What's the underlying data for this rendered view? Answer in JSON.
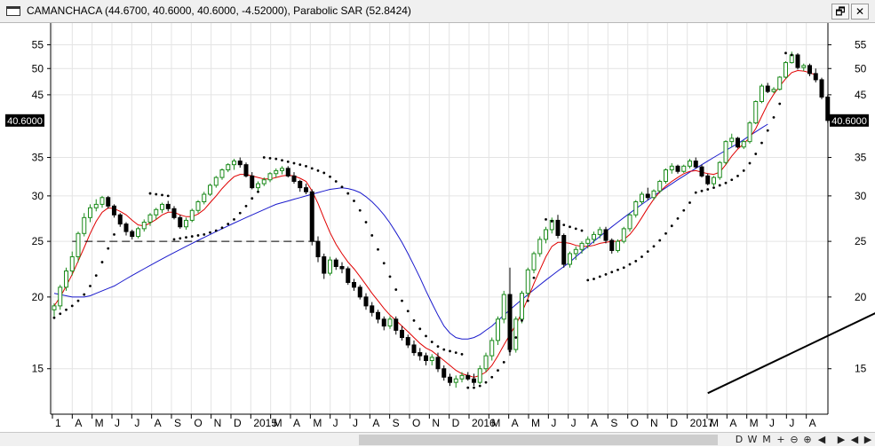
{
  "window": {
    "title": "CAMANCHACA (44.6700, 40.6000, 40.6000, -4.52000), Parabolic SAR (52.8424)",
    "restore_glyph": "🗗",
    "close_glyph": "✕"
  },
  "colors": {
    "up_candle": "#1a8a1a",
    "down_candle": "#000000",
    "ma_short": "#e00000",
    "ma_long": "#1a1acc",
    "sar": "#000000",
    "trendline": "#000000",
    "support": "#000000",
    "grid": "#e4e4e4",
    "price_label_bg": "#000000",
    "price_label_fg": "#ffffff"
  },
  "chart_data": {
    "type": "candlestick",
    "title": "CAMANCHACA (44.6700, 40.6000, 40.6000, -4.52000), Parabolic SAR (52.8424)",
    "period": "weekly",
    "y_scale": "log",
    "ylim": [
      12.5,
      60
    ],
    "y_ticks": [
      15,
      20,
      25,
      30,
      35,
      45,
      50,
      55
    ],
    "last_price_label": "40.6000",
    "last_price": 40.6,
    "grid": true,
    "x_ticks": [
      "1",
      "A",
      "M",
      "J",
      "J",
      "A",
      "S",
      "O",
      "N",
      "D",
      "2015",
      "M",
      "A",
      "M",
      "J",
      "J",
      "A",
      "S",
      "O",
      "N",
      "D",
      "2016",
      "M",
      "A",
      "M",
      "J",
      "J",
      "A",
      "S",
      "O",
      "N",
      "D",
      "2017",
      "M",
      "A",
      "M",
      "J",
      "J",
      "A"
    ],
    "bars": [
      [
        19,
        19.5,
        18.5,
        19.3
      ],
      [
        19.3,
        21,
        19,
        20.8
      ],
      [
        20.8,
        22.5,
        20.5,
        22.2
      ],
      [
        22.2,
        24,
        21.8,
        23.5
      ],
      [
        23.5,
        26,
        23,
        25.8
      ],
      [
        25.8,
        28,
        25.5,
        27.5
      ],
      [
        27.5,
        29,
        27,
        28.6
      ],
      [
        28.6,
        29.6,
        28.2,
        29
      ],
      [
        29,
        30,
        28.6,
        29.8
      ],
      [
        29.8,
        30,
        28.5,
        28.8
      ],
      [
        28.8,
        29,
        27.5,
        27.8
      ],
      [
        27.8,
        28,
        26.5,
        26.8
      ],
      [
        26.8,
        27,
        25.6,
        26
      ],
      [
        26,
        26.2,
        25.2,
        25.5
      ],
      [
        25.5,
        26.5,
        25.3,
        26.3
      ],
      [
        26.3,
        27.3,
        26,
        27
      ],
      [
        27,
        28,
        26.6,
        27.8
      ],
      [
        27.8,
        28.6,
        27.3,
        28.4
      ],
      [
        28.4,
        29.2,
        28,
        29
      ],
      [
        29,
        29.4,
        28.2,
        28.5
      ],
      [
        28.5,
        28.8,
        27.3,
        27.5
      ],
      [
        27.5,
        27.8,
        26.3,
        26.5
      ],
      [
        26.5,
        27.5,
        26.2,
        27.2
      ],
      [
        27.2,
        28.5,
        27,
        28.3
      ],
      [
        28.3,
        29.5,
        28,
        29.3
      ],
      [
        29.3,
        30.5,
        29,
        30.2
      ],
      [
        30.2,
        31.5,
        30,
        31.3
      ],
      [
        31.3,
        32.5,
        31,
        32.3
      ],
      [
        32.3,
        33.5,
        32,
        33.3
      ],
      [
        33.3,
        34.2,
        33,
        34
      ],
      [
        34,
        34.8,
        33.3,
        34.5
      ],
      [
        34.5,
        35,
        33.6,
        34
      ],
      [
        34,
        34.3,
        32.3,
        32.5
      ],
      [
        32.5,
        33,
        30.8,
        31
      ],
      [
        31,
        31.8,
        30.5,
        31.5
      ],
      [
        31.5,
        32.3,
        31.2,
        32
      ],
      [
        32,
        33,
        31.7,
        32.8
      ],
      [
        32.8,
        33.5,
        32.3,
        33.2
      ],
      [
        33.2,
        33.8,
        32.7,
        33.5
      ],
      [
        33.5,
        33.8,
        32.3,
        32.5
      ],
      [
        32.5,
        33,
        31.5,
        31.8
      ],
      [
        31.8,
        32,
        30.5,
        31
      ],
      [
        31,
        31.5,
        30.2,
        30.5
      ],
      [
        30.5,
        30.8,
        24.6,
        25
      ],
      [
        25,
        25.5,
        23,
        23.5
      ],
      [
        23.5,
        23.8,
        21.5,
        22
      ],
      [
        22,
        23.5,
        21.8,
        23.2
      ],
      [
        23.2,
        23.4,
        22.3,
        22.6
      ],
      [
        22.6,
        23,
        22,
        22.4
      ],
      [
        22.4,
        22.6,
        21,
        21.2
      ],
      [
        21.2,
        21.5,
        20.5,
        20.8
      ],
      [
        20.8,
        21,
        19.8,
        20
      ],
      [
        20,
        20.3,
        19,
        19.3
      ],
      [
        19.3,
        19.6,
        18.5,
        18.8
      ],
      [
        18.8,
        19,
        18,
        18.3
      ],
      [
        18.3,
        18.5,
        17.5,
        17.8
      ],
      [
        17.8,
        18.5,
        17.6,
        18.3
      ],
      [
        18.3,
        18.5,
        17.2,
        17.5
      ],
      [
        17.5,
        17.8,
        16.8,
        17
      ],
      [
        17,
        17.2,
        16.3,
        16.5
      ],
      [
        16.5,
        16.8,
        15.8,
        16
      ],
      [
        16,
        16.3,
        15.5,
        15.8
      ],
      [
        15.8,
        16,
        15.2,
        15.5
      ],
      [
        15.5,
        15.9,
        15.2,
        15.7
      ],
      [
        15.7,
        16,
        14.8,
        15
      ],
      [
        15,
        15.2,
        14.3,
        14.5
      ],
      [
        14.5,
        14.7,
        14,
        14.2
      ],
      [
        14.2,
        14.6,
        13.9,
        14.4
      ],
      [
        14.4,
        14.8,
        14.2,
        14.6
      ],
      [
        14.6,
        14.8,
        14.3,
        14.4
      ],
      [
        14.4,
        14.7,
        14,
        14.2
      ],
      [
        14.2,
        15.2,
        14.1,
        15
      ],
      [
        15,
        16,
        14.8,
        15.8
      ],
      [
        15.8,
        17,
        15.5,
        16.8
      ],
      [
        16.8,
        18.5,
        16.5,
        18.3
      ],
      [
        18.3,
        20.5,
        18,
        20.2
      ],
      [
        20.2,
        22.5,
        15.8,
        16.2
      ],
      [
        16.2,
        18.5,
        16,
        18.3
      ],
      [
        18.3,
        20.5,
        18,
        20.3
      ],
      [
        20.3,
        22.5,
        20,
        22.3
      ],
      [
        22.3,
        24,
        22,
        23.8
      ],
      [
        23.8,
        25.5,
        23.5,
        25.2
      ],
      [
        25.2,
        26.5,
        24.8,
        26.2
      ],
      [
        26.2,
        27.5,
        25.8,
        27.2
      ],
      [
        27.2,
        27.8,
        25.3,
        25.6
      ],
      [
        25.6,
        25.8,
        22.5,
        22.8
      ],
      [
        22.8,
        24,
        22.5,
        23.8
      ],
      [
        23.8,
        24.5,
        23.2,
        24.2
      ],
      [
        24.2,
        25,
        23.8,
        24.8
      ],
      [
        24.8,
        25.5,
        24.3,
        25.2
      ],
      [
        25.2,
        26,
        24.8,
        25.7
      ],
      [
        25.7,
        26.5,
        25.3,
        26.2
      ],
      [
        26.2,
        26.5,
        24.8,
        25.1
      ],
      [
        25.1,
        25.3,
        23.8,
        24.1
      ],
      [
        24.1,
        25.2,
        23.9,
        25
      ],
      [
        25,
        26.5,
        24.8,
        26.3
      ],
      [
        26.3,
        28,
        26,
        27.8
      ],
      [
        27.8,
        29.5,
        27.5,
        29.3
      ],
      [
        29.3,
        30.5,
        29,
        30.2
      ],
      [
        30.2,
        31,
        29.5,
        29.8
      ],
      [
        29.8,
        30.8,
        29.5,
        30.6
      ],
      [
        30.6,
        32,
        30.3,
        31.8
      ],
      [
        31.8,
        33.5,
        31.5,
        33.3
      ],
      [
        33.3,
        34.2,
        32.8,
        33.8
      ],
      [
        33.8,
        34,
        32.8,
        33.1
      ],
      [
        33.1,
        34,
        32.9,
        33.8
      ],
      [
        33.8,
        34.8,
        33.5,
        34.5
      ],
      [
        34.5,
        35,
        33.5,
        33.7
      ],
      [
        33.7,
        34,
        32.3,
        32.5
      ],
      [
        32.5,
        32.8,
        31.3,
        31.5
      ],
      [
        31.5,
        32.5,
        31.2,
        32.3
      ],
      [
        32.3,
        34.5,
        32,
        34.3
      ],
      [
        34.3,
        37.5,
        34,
        37.3
      ],
      [
        37.3,
        38.5,
        36.5,
        37.8
      ],
      [
        37.8,
        38,
        36.3,
        36.5
      ],
      [
        36.5,
        37.5,
        36.2,
        37.3
      ],
      [
        37.3,
        40.5,
        37,
        40.2
      ],
      [
        40.2,
        44,
        40,
        43.8
      ],
      [
        43.8,
        47,
        43.5,
        46.6
      ],
      [
        46.6,
        47.2,
        45.3,
        45.6
      ],
      [
        45.6,
        46.4,
        45.3,
        46
      ],
      [
        46,
        48.5,
        45.8,
        48.3
      ],
      [
        48.3,
        51.5,
        48,
        51.2
      ],
      [
        51.2,
        53.5,
        51,
        52.8
      ],
      [
        52.8,
        53.2,
        49.8,
        50.2
      ],
      [
        50.2,
        51,
        49.5,
        50.6
      ],
      [
        50.6,
        51,
        48.5,
        49
      ],
      [
        49,
        50,
        47.3,
        47.8
      ],
      [
        47.8,
        48.2,
        44.2,
        44.6
      ],
      [
        44.6,
        45,
        40.2,
        40.6
      ]
    ],
    "series": [
      {
        "name": "Parabolic SAR",
        "style": "dots",
        "values": [
          18.4,
          18.7,
          19,
          19.3,
          19.7,
          20.2,
          20.9,
          21.8,
          23,
          24.3,
          25.7,
          null,
          null,
          null,
          null,
          null,
          30.3,
          30.2,
          30.1,
          30,
          25.2,
          25.3,
          25.4,
          25.5,
          25.6,
          25.7,
          25.9,
          26.1,
          26.4,
          26.8,
          27.3,
          28,
          28.8,
          29.7,
          30.5,
          35,
          34.9,
          34.8,
          34.6,
          34.4,
          34.2,
          34,
          33.8,
          33.5,
          33.2,
          32.9,
          32.4,
          31.8,
          31.1,
          30.3,
          29.4,
          28.3,
          27,
          25.6,
          24.2,
          22.9,
          21.7,
          20.6,
          19.7,
          18.9,
          18.2,
          17.6,
          17.1,
          16.7,
          16.4,
          16.2,
          16.1,
          16,
          15.9,
          13.9,
          13.9,
          14,
          14.2,
          14.5,
          14.9,
          15.4,
          16.1,
          17,
          18.2,
          19.7,
          21.6,
          null,
          27.3,
          27.1,
          26.9,
          26.7,
          26.5,
          26.3,
          26.1,
          21.4,
          21.5,
          21.7,
          21.9,
          22.1,
          22.3,
          22.5,
          22.8,
          23.1,
          23.5,
          24,
          24.5,
          25.1,
          25.8,
          26.6,
          27.4,
          28.3,
          29.2,
          30.4,
          30.6,
          30.8,
          31,
          31.3,
          31.6,
          32,
          32.5,
          33.2,
          34.2,
          35.5,
          37.1,
          39,
          41.1,
          43.4,
          53.2,
          52.8
        ]
      },
      {
        "name": "MA short",
        "style": "line",
        "values": [
          19.3,
          20,
          20.9,
          21.9,
          23.1,
          24.4,
          25.8,
          27.1,
          28.1,
          28.6,
          28.5,
          28.2,
          27.8,
          27.2,
          26.7,
          26.6,
          26.9,
          27.3,
          27.8,
          28.1,
          28.1,
          27.8,
          27.6,
          27.6,
          27.9,
          28.4,
          29.2,
          30,
          30.9,
          31.7,
          32.4,
          32.7,
          32.7,
          32.5,
          32.3,
          32.1,
          32.1,
          32.3,
          32.5,
          32.6,
          32.5,
          32.2,
          31.8,
          30.6,
          29.1,
          27.4,
          25.9,
          24.7,
          23.8,
          23,
          22.4,
          21.7,
          21,
          20.3,
          19.7,
          19.1,
          18.6,
          18.2,
          17.8,
          17.4,
          17,
          16.6,
          16.3,
          16.1,
          15.8,
          15.5,
          15.2,
          14.9,
          14.7,
          14.6,
          14.5,
          14.6,
          14.8,
          15.2,
          15.8,
          16.5,
          17.2,
          17.9,
          18.8,
          19.9,
          21.1,
          22.3,
          23.5,
          24.5,
          24.9,
          24.9,
          24.8,
          24.6,
          24.5,
          24.5,
          24.6,
          24.8,
          24.9,
          25,
          25,
          25.2,
          25.7,
          26.5,
          27.5,
          28.6,
          29.6,
          30.5,
          31.2,
          31.8,
          32.3,
          32.8,
          33.1,
          33.2,
          33,
          32.8,
          32.7,
          33,
          34,
          35.2,
          36.2,
          37,
          37.9,
          39.3,
          41.3,
          43.4,
          45.1,
          46.6,
          48,
          49.2,
          49.6,
          49.5,
          49.2,
          48.7
        ]
      },
      {
        "name": "MA long",
        "style": "line",
        "values": [
          20.3,
          20.2,
          20.1,
          20,
          20,
          20,
          20.1,
          20.3,
          20.5,
          20.7,
          20.9,
          21.2,
          21.5,
          21.8,
          22.1,
          22.4,
          22.7,
          23,
          23.3,
          23.6,
          23.9,
          24.2,
          24.5,
          24.8,
          25.1,
          25.4,
          25.7,
          26,
          26.3,
          26.6,
          26.9,
          27.2,
          27.5,
          27.8,
          28.1,
          28.4,
          28.7,
          29,
          29.2,
          29.4,
          29.6,
          29.8,
          30,
          30.2,
          30.4,
          30.6,
          30.8,
          30.9,
          31,
          30.9,
          30.7,
          30.4,
          29.9,
          29.3,
          28.6,
          27.8,
          26.9,
          25.9,
          24.9,
          23.8,
          22.7,
          21.6,
          20.5,
          19.5,
          18.6,
          17.8,
          17.3,
          17,
          16.9,
          16.9,
          17,
          17.2,
          17.5,
          17.8,
          18.2,
          18.6,
          19,
          19.4,
          19.8,
          20.2,
          20.6,
          21,
          21.4,
          21.8,
          22.2,
          22.6,
          23,
          23.5,
          24,
          24.5,
          25,
          25.5,
          26,
          26.5,
          27,
          27.5,
          28,
          28.5,
          29,
          29.5,
          30,
          30.5,
          31,
          31.5,
          32,
          32.5,
          33,
          33.5,
          34,
          34.5,
          35,
          35.5,
          36,
          36.5,
          37,
          37.6,
          38.2,
          38.8,
          39.4,
          40
        ]
      },
      {
        "name": "Trendline",
        "style": "line",
        "points": [
          [
            109,
            13.6
          ],
          [
            225,
            51.5
          ]
        ]
      },
      {
        "name": "Support",
        "style": "dashed",
        "points": [
          [
            3,
            25
          ],
          [
            44,
            25
          ]
        ]
      }
    ]
  },
  "nav": {
    "d": "D",
    "w": "W",
    "m": "M",
    "zoom_in": "+",
    "zoom_out": "⊖",
    "reset": "⊕",
    "prev": "◀",
    "next": "▶",
    "first": "◀",
    "last": "▶"
  }
}
